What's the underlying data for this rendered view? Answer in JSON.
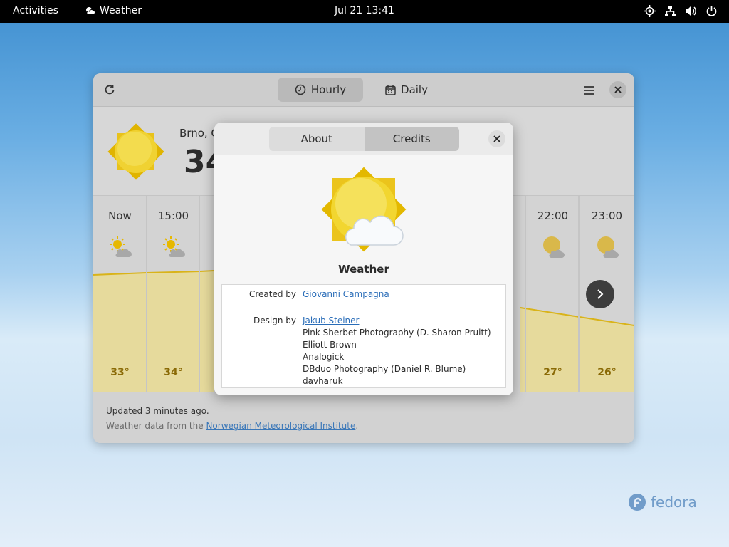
{
  "topbar": {
    "activities": "Activities",
    "app_name": "Weather",
    "clock": "Jul 21  13:41"
  },
  "window": {
    "tabs": [
      {
        "label": "Hourly",
        "icon": "clock-icon",
        "selected": true
      },
      {
        "label": "Daily",
        "icon": "calendar-icon",
        "selected": false
      }
    ],
    "current": {
      "city": "Brno, C",
      "temperature": "34"
    },
    "hourly": [
      {
        "time": "Now",
        "temp": "33°",
        "icon": "sun-cloud-icon"
      },
      {
        "time": "15:00",
        "temp": "34°",
        "icon": "sun-cloud-icon"
      },
      {
        "time": "22:00",
        "temp": "27°",
        "icon": "moon-cloud-icon"
      },
      {
        "time": "23:00",
        "temp": "26°",
        "icon": "moon-cloud-icon"
      }
    ],
    "footer": {
      "updated": "Updated 3 minutes ago.",
      "source_prefix": "Weather data from the ",
      "source_link": "Norwegian Meteorological Institute",
      "source_suffix": "."
    }
  },
  "dialog": {
    "tabs": [
      {
        "label": "About",
        "selected": false
      },
      {
        "label": "Credits",
        "selected": true
      }
    ],
    "app_name": "Weather",
    "credits": {
      "created_by_label": "Created by",
      "created_by": "Giovanni Campagna",
      "design_by_label": "Design by",
      "designers": [
        "Jakub Steiner",
        "Pink Sherbet Photography (D. Sharon Pruitt)",
        "Elliott Brown",
        "Analogick",
        "DBduo Photography (Daniel R. Blume)",
        "davharuk"
      ]
    }
  },
  "desktop": {
    "logo_text": "fedora"
  },
  "colors": {
    "graph_fill": "#e9dc9a",
    "graph_line": "#d9b319",
    "sun": "#f4cf21",
    "link": "#2a6db8"
  }
}
